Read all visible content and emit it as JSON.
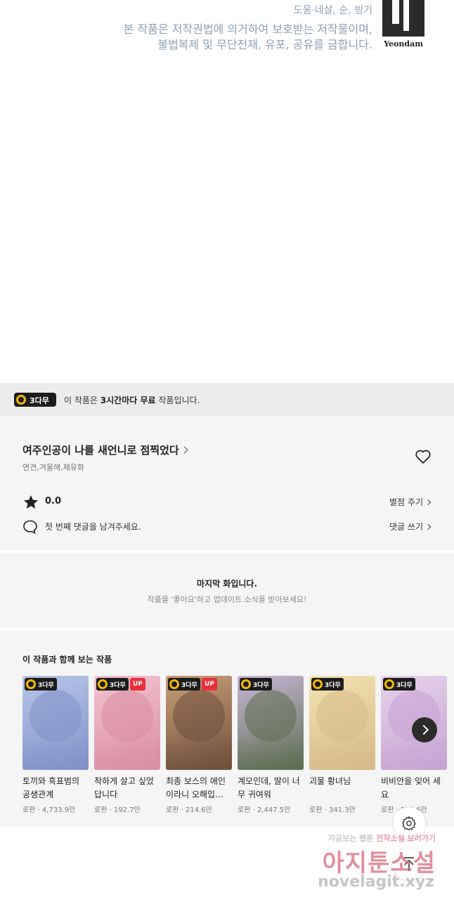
{
  "copyright": {
    "line1": "도움·네살, 순, 빙기",
    "line2": "본 작품은 저작권법에 의거하여 보호받는 저작물이며,",
    "line3": "불법복제 및 무단전재, 유포, 공유를 금합니다.",
    "logo_text": "Yeondam"
  },
  "free_bar": {
    "badge": "3다무",
    "text_prefix": "이 작품은 ",
    "text_bold": "3시간마다 무료",
    "text_suffix": " 작품입니다."
  },
  "work": {
    "title": "여주인공이 나를 새언니로 점찍었다",
    "authors": "연견,겨울해,채유화",
    "rating": "0.0",
    "rate_label": "별점 주기",
    "comment_prompt": "첫 번째 댓글을 남겨주세요.",
    "comment_label": "댓글 쓰기"
  },
  "last_episode": {
    "title": "마지막 화입니다.",
    "subtitle": "작품을 '좋아요'하고 업데이트 소식을 받아보세요!"
  },
  "recommendations": {
    "heading": "이 작품과 함께 보는 작품",
    "badge_label": "3다무",
    "up_label": "UP",
    "items": [
      {
        "title": "토끼와 흑표범의 공생관계",
        "meta": "로판 · 4,733.9만",
        "up": false,
        "c1": "#b7c6e8",
        "c2": "#7f92c9"
      },
      {
        "title": "착하게 살고 싶었답니다",
        "meta": "로판 · 192.7만",
        "up": true,
        "c1": "#f3c3cf",
        "c2": "#d98ea2"
      },
      {
        "title": "최종 보스의 애인이라니 오해입…",
        "meta": "로판 · 214.6만",
        "up": true,
        "c1": "#c8a07a",
        "c2": "#6f4e3a"
      },
      {
        "title": "계모인데, 딸이 너무 귀여워",
        "meta": "로판 · 2,447.5만",
        "up": false,
        "c1": "#c9b7d8",
        "c2": "#5c6e4f"
      },
      {
        "title": "괴물 황녀님",
        "meta": "로판 · 341.3만",
        "up": false,
        "c1": "#f1e3b0",
        "c2": "#d7b98a"
      },
      {
        "title": "비비안을 잊어 세요",
        "meta": "로판 · 112.6만",
        "up": false,
        "c1": "#e6d3ec",
        "c2": "#c6a3d3"
      }
    ]
  },
  "watermark": {
    "line1_a": "지금보는 웹툰 ",
    "line1_b": "전작소설 ",
    "line1_c": "보러가기",
    "line2": "아지툰소설",
    "line3": "novelagit.xyz"
  }
}
